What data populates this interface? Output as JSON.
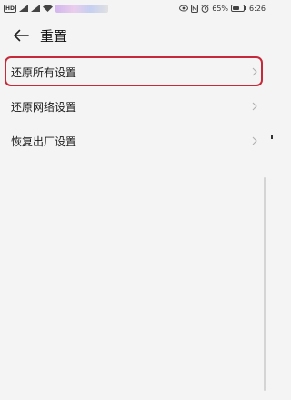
{
  "status_bar": {
    "network_type": "HD",
    "battery_percent": "65%",
    "time": "6:26",
    "battery_level": 0.65,
    "icons": [
      "signal-icon",
      "signal-icon",
      "wifi-icon",
      "eye-icon",
      "nfc-icon",
      "alarm-icon",
      "battery-icon"
    ]
  },
  "header": {
    "back_icon": "arrow-left-icon",
    "title": "重置"
  },
  "list": {
    "items": [
      {
        "label": "还原所有设置",
        "icon": "chevron-right-icon",
        "highlighted": true
      },
      {
        "label": "还原网络设置",
        "icon": "chevron-right-icon",
        "highlighted": false
      },
      {
        "label": "恢复出厂设置",
        "icon": "chevron-right-icon",
        "highlighted": false
      }
    ]
  },
  "colors": {
    "background": "#f4f4f4",
    "highlight": "#c62a3a",
    "chevron": "#b0b0b0"
  }
}
